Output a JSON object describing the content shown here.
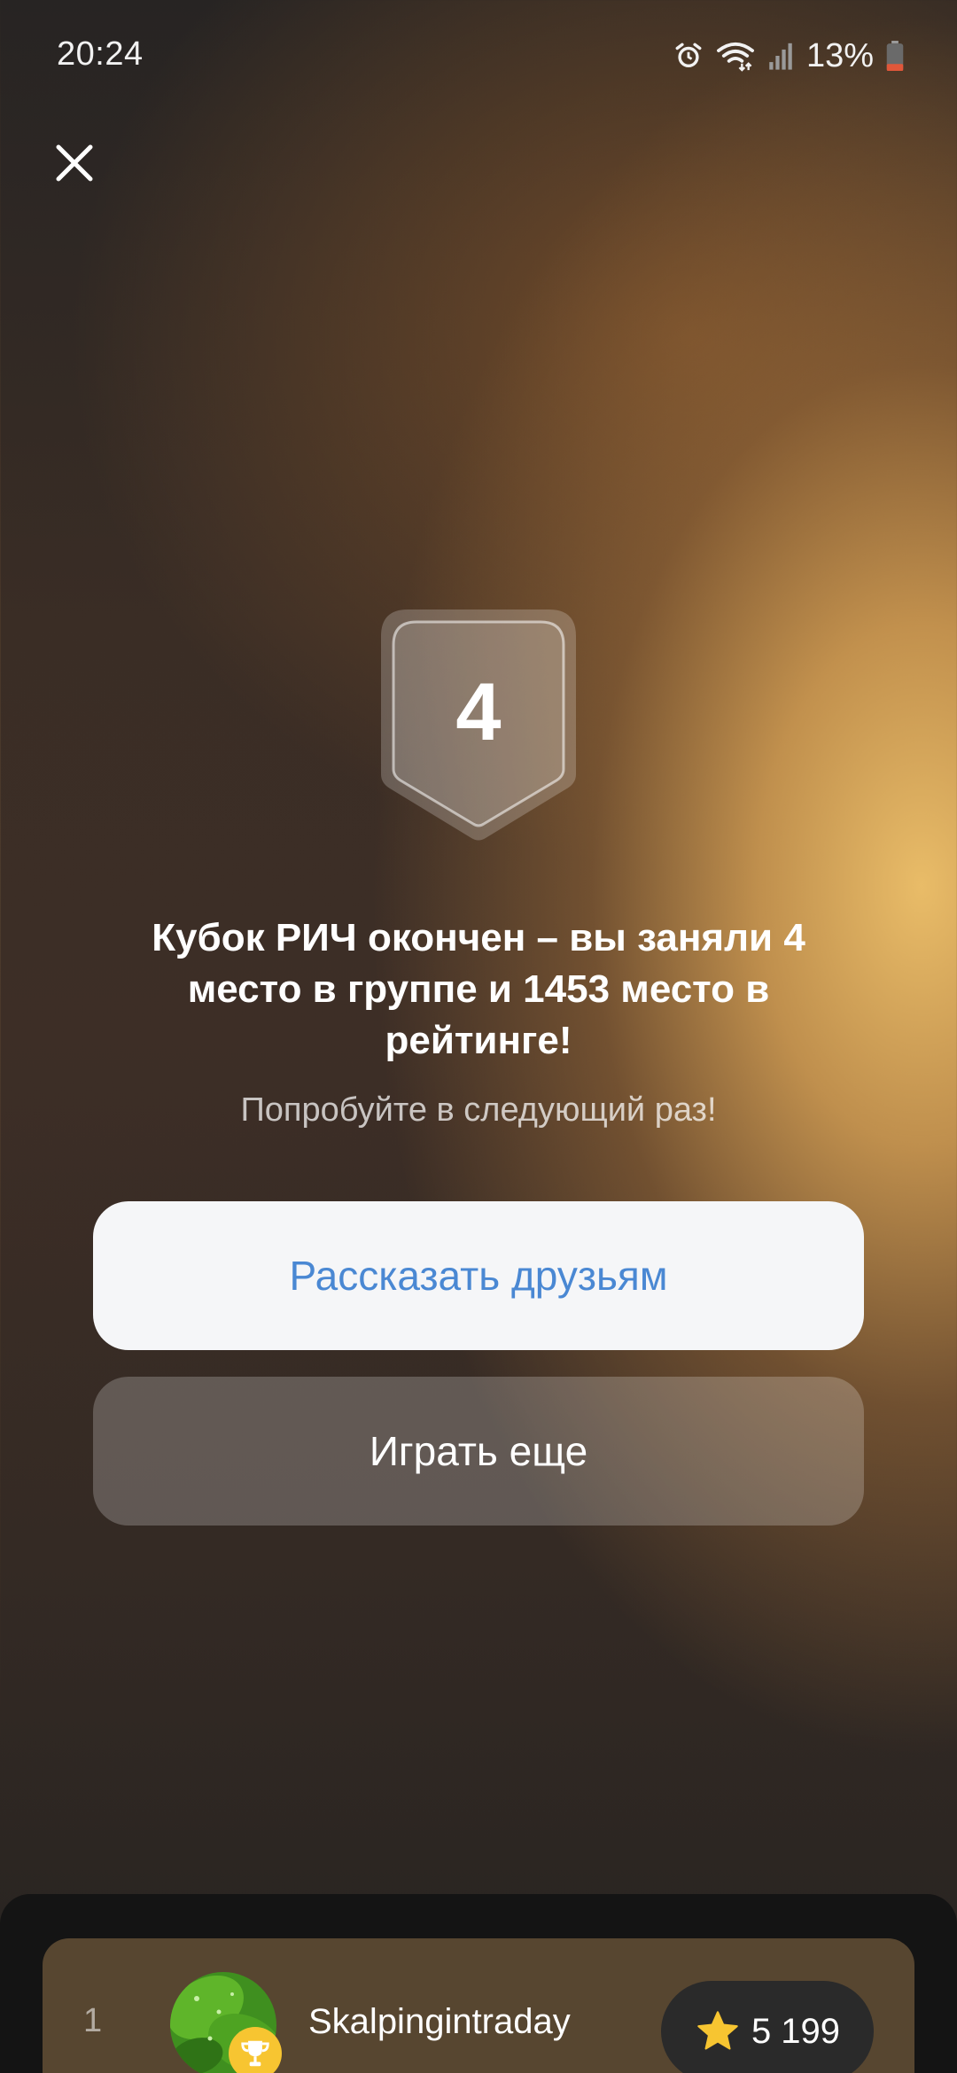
{
  "status_bar": {
    "time": "20:24",
    "battery": "13%",
    "icons": [
      "alarm-icon",
      "wifi-icon",
      "signal-icon",
      "battery-icon"
    ]
  },
  "close_icon": "close-icon",
  "result": {
    "rank": "4",
    "title": "Кубок РИЧ окончен – вы заняли 4 место в группе и 1453 место в рейтинге!",
    "subtitle": "Попробуйте в следующий раз!"
  },
  "buttons": {
    "share_label": "Рассказать друзьям",
    "play_label": "Играть еще"
  },
  "leaderboard": {
    "rows": [
      {
        "rank": "1",
        "name": "Skalpingintraday",
        "score": "5 199",
        "avatar_icon": "avatar-leaves",
        "badge_icon": "trophy-icon",
        "score_icon": "star-icon"
      }
    ]
  },
  "colors": {
    "share_text": "#4a88d3",
    "star": "#f7c531",
    "row_background": "#574630"
  }
}
